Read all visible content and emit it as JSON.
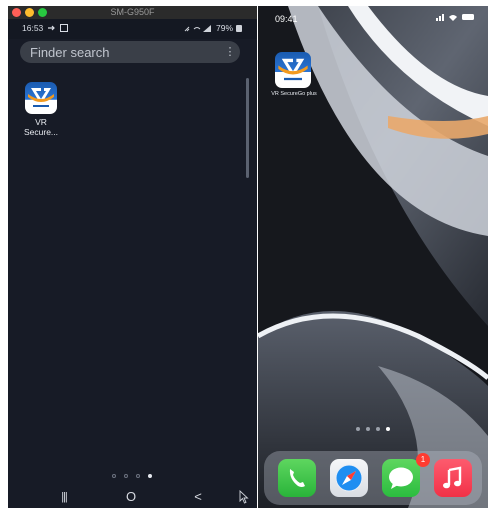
{
  "android": {
    "window_title": "SM-G950F",
    "status": {
      "time": "16:53",
      "battery": "79%"
    },
    "finder": {
      "placeholder": "Finder search",
      "more": "⋮"
    },
    "app": {
      "label_line1": "VR",
      "label_line2": "Secure..."
    },
    "page_dots": {
      "count": 4,
      "active": 4
    },
    "nav": {
      "recents": "|||",
      "home": "O",
      "back": "<"
    }
  },
  "iphone": {
    "status": {
      "time": "09:41"
    },
    "app": {
      "label": "VR SecureGo plus"
    },
    "page_dots": {
      "count": 4,
      "active": 4
    },
    "dock": {
      "apps": [
        "Phone",
        "Safari",
        "Messages",
        "Music"
      ],
      "messages_badge": "1"
    }
  },
  "colors": {
    "android_bg": "#171b26",
    "iphone_bg": "#121418",
    "vr_blue": "#1a5bb0",
    "vr_orange": "#f39a1e"
  },
  "icons": [
    "red-traffic-light",
    "yellow-traffic-light",
    "green-traffic-light",
    "more-vert-icon",
    "vr-securego-icon",
    "phone-icon",
    "safari-compass-icon",
    "messages-bubble-icon",
    "music-note-icon",
    "mouse-pointer-icon"
  ]
}
